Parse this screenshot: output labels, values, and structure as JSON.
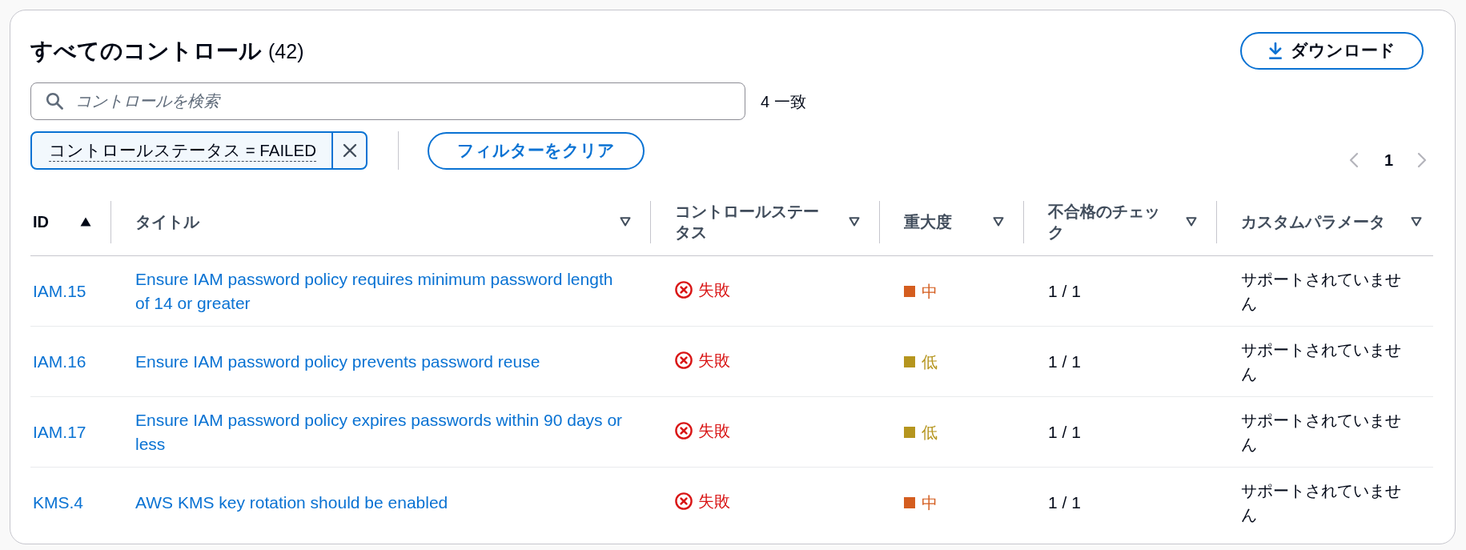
{
  "panel": {
    "title": "すべてのコントロール",
    "count": "(42)",
    "download_button": {
      "label": "ダウンロード"
    }
  },
  "search": {
    "placeholder": "コントロールを検索",
    "match_count": "4 一致"
  },
  "filters": {
    "tokens": [
      {
        "label": "コントロールステータス = FAILED"
      }
    ],
    "clear_button": {
      "label": "フィルターをクリア"
    }
  },
  "pagination": {
    "previous": {
      "disabled": true
    },
    "pages": [
      {
        "label": "1",
        "selected": true
      }
    ],
    "next": {
      "disabled": true
    }
  },
  "table": {
    "columns": [
      {
        "label": "ID",
        "sorted": true
      },
      {
        "label": "タイトル",
        "sorted": false
      },
      {
        "label": "コントロールステータス",
        "sorted": false
      },
      {
        "label": "重大度",
        "sorted": false
      },
      {
        "label": "不合格のチェック",
        "sorted": false
      },
      {
        "label": "カスタムパラメータ",
        "sorted": false
      }
    ],
    "rows": [
      {
        "id": "IAM.15",
        "title": "Ensure IAM password policy requires minimum password length of 14 or greater",
        "status": {
          "kind": "failed",
          "text": "失敗"
        },
        "severity": {
          "text": "中",
          "color": "#d45d1f"
        },
        "failed_checks": "1 / 1",
        "custom_parameters": "サポートされていません"
      },
      {
        "id": "IAM.16",
        "title": "Ensure IAM password policy prevents password reuse",
        "status": {
          "kind": "failed",
          "text": "失敗"
        },
        "severity": {
          "text": "低",
          "color": "#b5951e"
        },
        "failed_checks": "1 / 1",
        "custom_parameters": "サポートされていません"
      },
      {
        "id": "IAM.17",
        "title": "Ensure IAM password policy expires passwords within 90 days or less",
        "status": {
          "kind": "failed",
          "text": "失敗"
        },
        "severity": {
          "text": "低",
          "color": "#b5951e"
        },
        "failed_checks": "1 / 1",
        "custom_parameters": "サポートされていません"
      },
      {
        "id": "KMS.4",
        "title": "AWS KMS key rotation should be enabled",
        "status": {
          "kind": "failed",
          "text": "失敗"
        },
        "severity": {
          "text": "中",
          "color": "#d45d1f"
        },
        "failed_checks": "1 / 1",
        "custom_parameters": "サポートされていません"
      }
    ]
  }
}
